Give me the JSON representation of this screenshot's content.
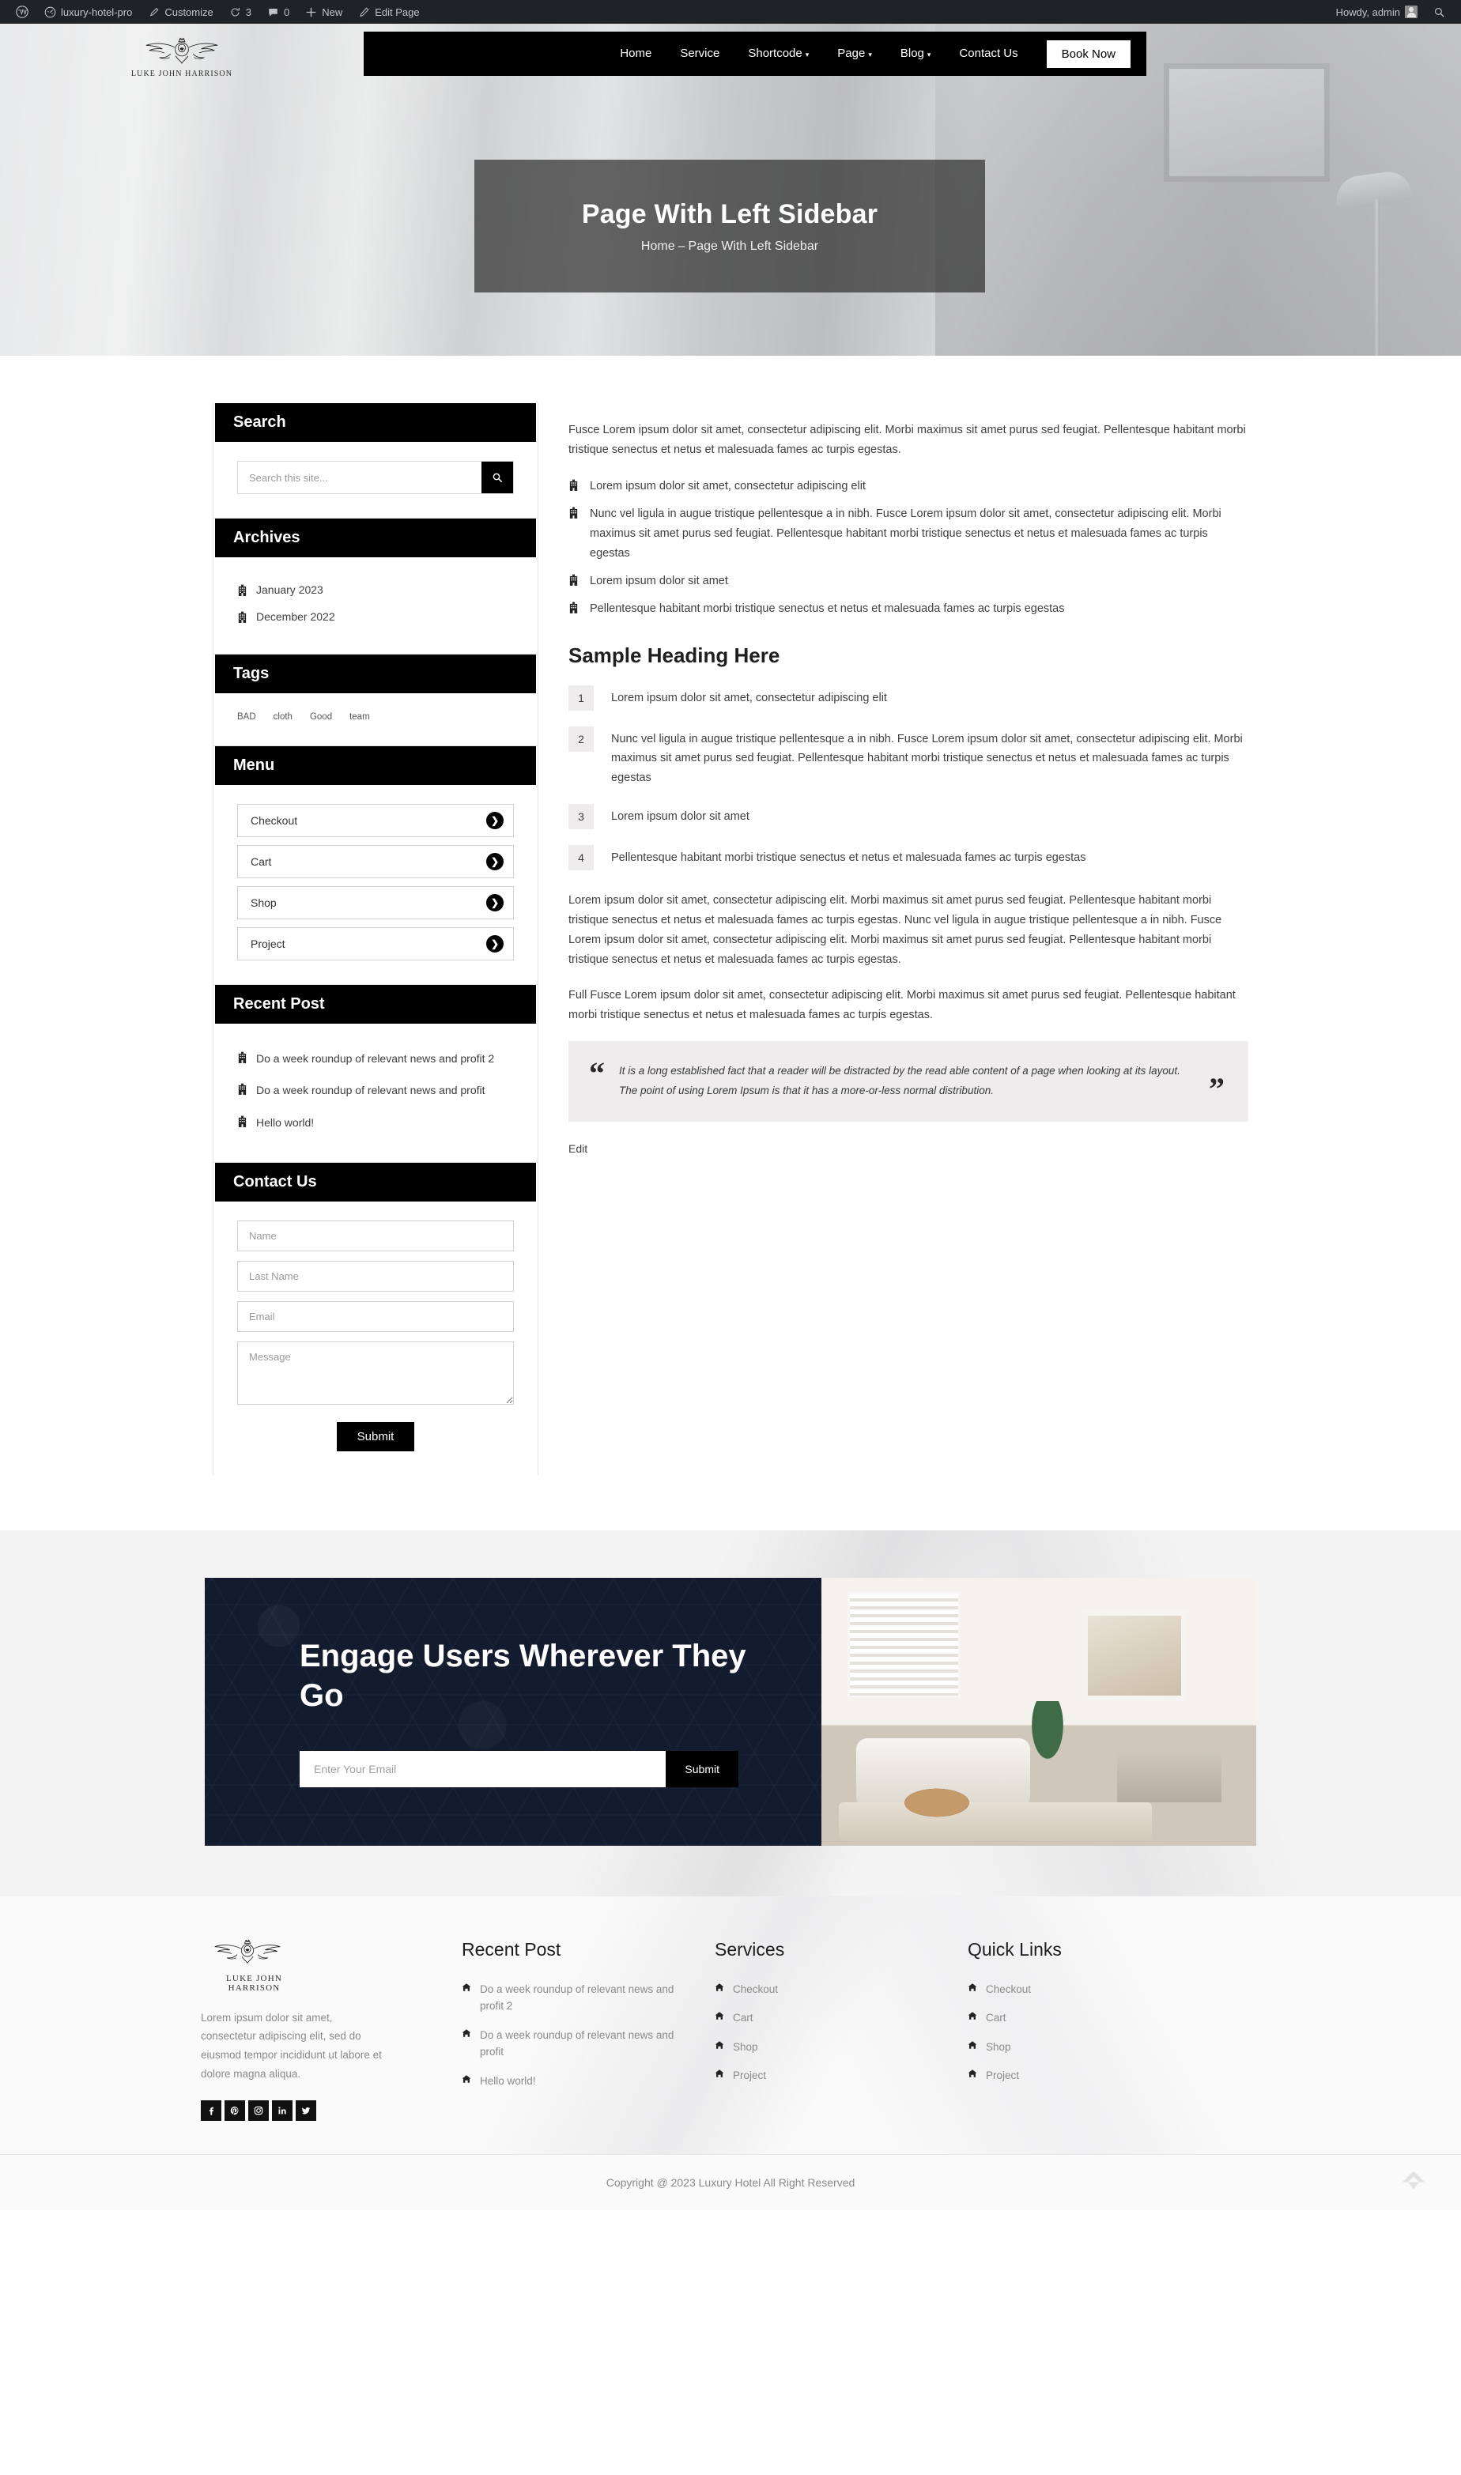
{
  "adminbar": {
    "wp_logo_icon": "wordpress-icon",
    "site_name": "luxury-hotel-pro",
    "site_icon": "dashboard-icon",
    "customize": "Customize",
    "customize_icon": "brush-icon",
    "updates_icon": "updates-icon",
    "updates_count": "3",
    "comments_icon": "comment-icon",
    "comments_count": "0",
    "new_icon": "plus-icon",
    "new": "New",
    "edit_icon": "pencil-icon",
    "edit_page": "Edit Page",
    "howdy": "Howdy, admin",
    "avatar_icon": "avatar-icon",
    "search_icon": "search-icon"
  },
  "header": {
    "brand_name": "LUKE JOHN HARRISON",
    "logo_icon": "winged-crest-logo",
    "nav": [
      {
        "label": "Home",
        "has_caret": false
      },
      {
        "label": "Service",
        "has_caret": false
      },
      {
        "label": "Shortcode",
        "has_caret": true
      },
      {
        "label": "Page",
        "has_caret": true
      },
      {
        "label": "Blog",
        "has_caret": true
      },
      {
        "label": "Contact Us",
        "has_caret": false
      }
    ],
    "book_now": "Book Now"
  },
  "banner": {
    "title": "Page With Left Sidebar",
    "crumb_home": "Home",
    "crumb_sep": "–",
    "crumb_current": "Page With Left Sidebar"
  },
  "sidebar": {
    "search": {
      "title": "Search",
      "placeholder": "Search this site...",
      "button_icon": "search-icon"
    },
    "archives": {
      "title": "Archives",
      "items": [
        {
          "icon": "building-icon",
          "label": "January 2023"
        },
        {
          "icon": "building-icon",
          "label": "December 2022"
        }
      ]
    },
    "tags": {
      "title": "Tags",
      "items": [
        "BAD",
        "cloth",
        "Good",
        "team"
      ]
    },
    "menu": {
      "title": "Menu",
      "items": [
        {
          "label": "Checkout",
          "icon": "chevron-right-circle-icon"
        },
        {
          "label": "Cart",
          "icon": "chevron-right-circle-icon"
        },
        {
          "label": "Shop",
          "icon": "chevron-right-circle-icon"
        },
        {
          "label": "Project",
          "icon": "chevron-right-circle-icon"
        }
      ]
    },
    "recent": {
      "title": "Recent Post",
      "items": [
        {
          "icon": "building-icon",
          "label": "Do a week roundup of relevant news and profit 2"
        },
        {
          "icon": "building-icon",
          "label": "Do a week roundup of relevant news and profit"
        },
        {
          "icon": "building-icon",
          "label": "Hello world!"
        }
      ]
    },
    "contact": {
      "title": "Contact Us",
      "name_placeholder": "Name",
      "lastname_placeholder": "Last Name",
      "email_placeholder": "Email",
      "message_placeholder": "Message",
      "submit": "Submit"
    }
  },
  "content": {
    "intro": "Fusce Lorem ipsum dolor sit amet, consectetur adipiscing elit. Morbi maximus sit amet purus sed feugiat. Pellentesque habitant morbi tristique senectus et netus et malesuada fames ac turpis egestas.",
    "icon_list": [
      "Lorem ipsum dolor sit amet, consectetur adipiscing elit",
      "Nunc vel ligula in augue tristique pellentesque a in nibh. Fusce Lorem ipsum dolor sit amet, consectetur adipiscing elit. Morbi maximus sit amet purus sed feugiat. Pellentesque habitant morbi tristique senectus et netus et malesuada fames ac turpis egestas",
      "Lorem ipsum dolor sit amet",
      "Pellentesque habitant morbi tristique senectus et netus et malesuada fames ac turpis egestas"
    ],
    "heading": "Sample Heading Here",
    "numbered_list": [
      {
        "number": "1",
        "text": "Lorem ipsum dolor sit amet, consectetur adipiscing elit"
      },
      {
        "number": "2",
        "text": "Nunc vel ligula in augue tristique pellentesque a in nibh. Fusce Lorem ipsum dolor sit amet, consectetur adipiscing elit. Morbi maximus sit amet purus sed feugiat. Pellentesque habitant morbi tristique senectus et netus et malesuada fames ac turpis egestas"
      },
      {
        "number": "3",
        "text": "Lorem ipsum dolor sit amet"
      },
      {
        "number": "4",
        "text": "Pellentesque habitant morbi tristique senectus et netus et malesuada fames ac turpis egestas"
      }
    ],
    "para1": "Lorem ipsum dolor sit amet, consectetur adipiscing elit. Morbi maximus sit amet purus sed feugiat. Pellentesque habitant morbi tristique senectus et netus et malesuada fames ac turpis egestas. Nunc vel ligula in augue tristique pellentesque a in nibh. Fusce Lorem ipsum dolor sit amet, consectetur adipiscing elit. Morbi maximus sit amet purus sed feugiat. Pellentesque habitant morbi tristique senectus et netus et malesuada fames ac turpis egestas.",
    "para2": "Full Fusce Lorem ipsum dolor sit amet, consectetur adipiscing elit. Morbi maximus sit amet purus sed feugiat. Pellentesque habitant morbi tristique senectus et netus et malesuada fames ac turpis egestas.",
    "quote": "It is a long established fact that a reader will be distracted by the read able content of a page when looking at its layout. The point of using Lorem Ipsum is that it has a more-or-less normal distribution.",
    "quote_open": "“",
    "quote_close": "”",
    "edit": "Edit"
  },
  "cta": {
    "heading": "Engage Users Wherever They Go",
    "email_placeholder": "Enter Your Email",
    "submit": "Submit"
  },
  "footer": {
    "brand_name": "LUKE JOHN HARRISON",
    "logo_icon": "winged-crest-logo",
    "description": "Lorem ipsum dolor sit amet, consectetur adipiscing elit, sed do eiusmod tempor incididunt ut labore et dolore magna aliqua.",
    "socials": [
      {
        "icon": "facebook-icon",
        "glyph": "f"
      },
      {
        "icon": "pinterest-icon",
        "glyph": "P"
      },
      {
        "icon": "instagram-icon",
        "glyph": "◉"
      },
      {
        "icon": "linkedin-icon",
        "glyph": "in"
      },
      {
        "icon": "twitter-icon",
        "glyph": "t"
      }
    ],
    "recent": {
      "title": "Recent Post",
      "items": [
        "Do a week roundup of relevant news and profit 2",
        "Do a week roundup of relevant news and profit",
        "Hello world!"
      ]
    },
    "services": {
      "title": "Services",
      "items": [
        "Checkout",
        "Cart",
        "Shop",
        "Project"
      ]
    },
    "quicklinks": {
      "title": "Quick Links",
      "items": [
        "Checkout",
        "Cart",
        "Shop",
        "Project"
      ]
    },
    "copyright": "Copyright @ 2023 Luxury Hotel All Right Reserved",
    "to_top_icon": "arrow-up-icon"
  },
  "colors": {
    "accent_black": "#000000",
    "cta_navy": "#131b2e",
    "muted_text": "#8a8a8a",
    "quote_bg": "#eeecec"
  }
}
